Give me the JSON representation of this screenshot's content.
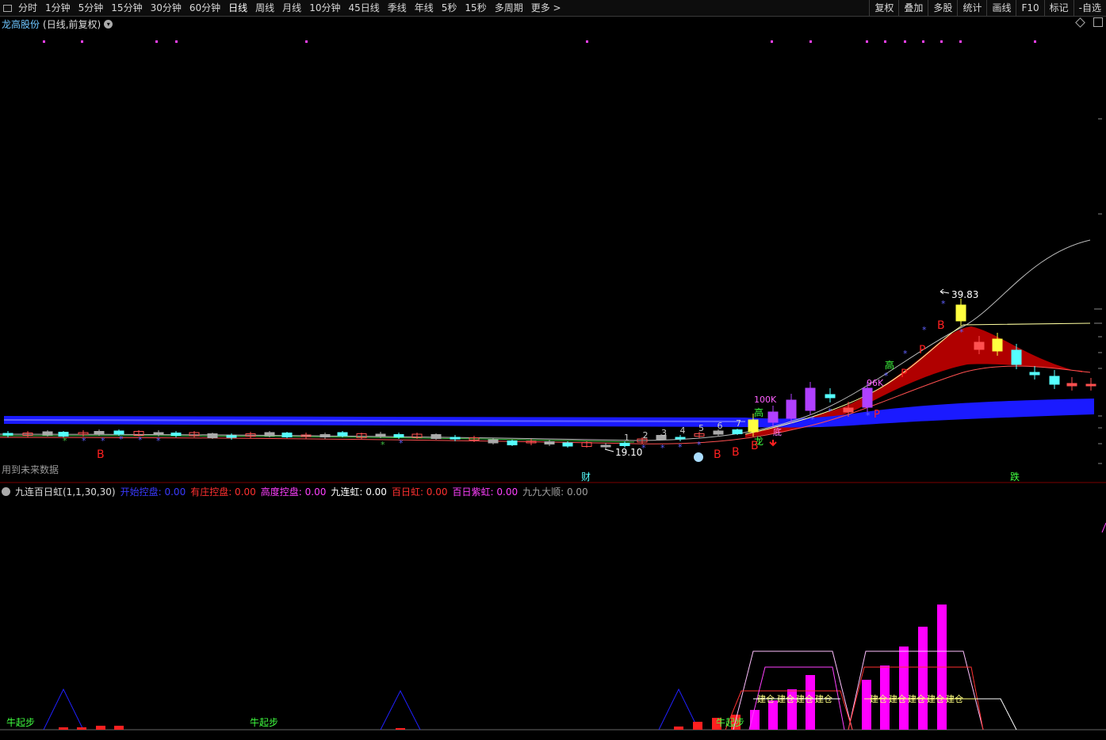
{
  "toolbar": {
    "periods": [
      "分时",
      "1分钟",
      "5分钟",
      "15分钟",
      "30分钟",
      "60分钟",
      "日线",
      "周线",
      "月线",
      "10分钟",
      "45日线",
      "季线",
      "年线",
      "5秒",
      "15秒",
      "多周期",
      "更多 >"
    ],
    "active_period": "日线",
    "right_buttons": [
      "复权",
      "叠加",
      "多股",
      "统计",
      "画线",
      "F10",
      "标记",
      "-自选"
    ]
  },
  "header": {
    "stock_name": "龙高股份",
    "mode": "(日线,前复权)"
  },
  "main_chart": {
    "future_data_note": "用到未来数据",
    "high_label": "39.83",
    "low_label": "19.10",
    "vol_labels": [
      "100K",
      "96K"
    ],
    "char_gao": "高",
    "char_di": "底",
    "char_long": "龙",
    "char_b": "B",
    "char_p": "P",
    "cai_label": "财",
    "die_label": "跌",
    "count_labels": [
      "1",
      "2",
      "3",
      "4",
      "5",
      "6",
      "7"
    ],
    "colors": {
      "band_blue": "#1a1aff",
      "band_red": "#b00000",
      "cyan": "#55ffff",
      "yellow": "#ffff40",
      "magenta": "#ff00ff"
    }
  },
  "indicator": {
    "name": "九连百日虹(1,1,30,30)",
    "fields": [
      {
        "label": "开始控盘",
        "value": "0.00",
        "color": "#3a3aff"
      },
      {
        "label": "有庄控盘",
        "value": "0.00",
        "color": "#ff3030"
      },
      {
        "label": "高度控盘",
        "value": "0.00",
        "color": "#ff40ff"
      },
      {
        "label": "九连虹",
        "value": "0.00",
        "color": "#ffffff"
      },
      {
        "label": "百日虹",
        "value": "0.00",
        "color": "#ff3030"
      },
      {
        "label": "百日紫虹",
        "value": "0.00",
        "color": "#ff40ff"
      },
      {
        "label": "九九大顺",
        "value": "0.00",
        "color": "#a0a0a0"
      }
    ],
    "niu_label": "牛起步",
    "jiancang_label": "建仓"
  }
}
